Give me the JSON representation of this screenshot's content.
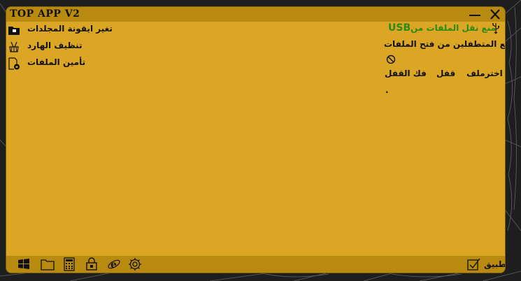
{
  "window": {
    "title": "TOP APP V2"
  },
  "left_menu": [
    {
      "label": "تغير ايقونة المجلدات",
      "icon": "folder-icon"
    },
    {
      "label": "تنظيف الهارد",
      "icon": "broom-icon"
    },
    {
      "label": "تأمين الملفات",
      "icon": "file-lock-icon"
    }
  ],
  "usb": {
    "text": "منع نقل الملفات من",
    "usb_word": "USB",
    "icon": "usb-icon"
  },
  "prevent_open": {
    "text": "امنع المتطفلين من فتح الملفات",
    "icon": "block-icon"
  },
  "actions": {
    "explore": "اخترملف",
    "lock": "قفل",
    "unlock": "فك القفل"
  },
  "status": {
    "text": "."
  },
  "taskbar": {
    "icons": [
      "windows-icon",
      "folder-icon",
      "calculator-icon",
      "lock-icon",
      "internet-explorer-icon",
      "gear-icon"
    ],
    "apply_label": "تطبيق",
    "apply_icon": "checkbox-icon"
  },
  "colors": {
    "window_bg": "#dba623",
    "bar_bg": "#b88a0f",
    "usb_green": "#2a8a12"
  }
}
